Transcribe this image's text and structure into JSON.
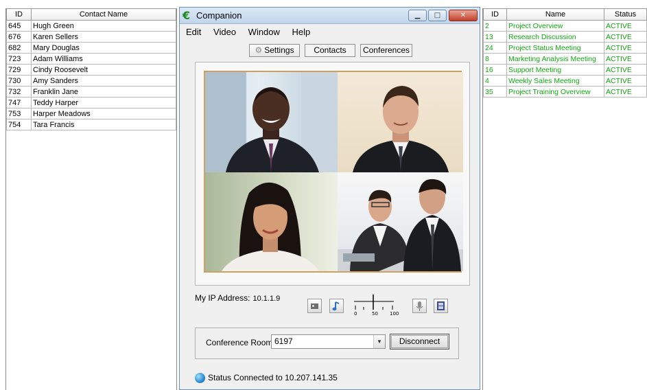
{
  "contacts": {
    "headers": [
      "ID",
      "Contact Name"
    ],
    "rows": [
      [
        "645",
        "Hugh Green"
      ],
      [
        "676",
        "Karen Sellers"
      ],
      [
        "682",
        "Mary Douglas"
      ],
      [
        "723",
        "Adam Williams"
      ],
      [
        "729",
        "Cindy Roosevelt"
      ],
      [
        "730",
        "Amy Sanders"
      ],
      [
        "732",
        "Franklin Jane"
      ],
      [
        "747",
        "Teddy Harper"
      ],
      [
        "753",
        "Harper Meadows"
      ],
      [
        "754",
        "Tara Francis"
      ]
    ]
  },
  "window": {
    "title": "Companion",
    "min_glyph": "▁",
    "max_glyph": "□",
    "close_glyph": "✕"
  },
  "menu": [
    "Edit",
    "Video",
    "Window",
    "Help"
  ],
  "tabs": {
    "settings": "Settings",
    "contacts": "Contacts",
    "conferences": "Conferences"
  },
  "ip": {
    "label": "My IP Address:",
    "value": "10.1.1.9"
  },
  "volume": {
    "ticks": [
      "0",
      "50",
      "100"
    ],
    "level": 0.5
  },
  "conference": {
    "label": "Conference Room",
    "value": "6197",
    "disconnect": "Disconnect"
  },
  "status": {
    "label": "Status",
    "text": "Connected to 10.207.141.35"
  },
  "meetings": {
    "headers": [
      "ID",
      "Name",
      "Status"
    ],
    "rows": [
      [
        "2",
        "Project Overview",
        "ACTIVE"
      ],
      [
        "13",
        "Research Discussion",
        "ACTIVE"
      ],
      [
        "24",
        "Project Status Meeting",
        "ACTIVE"
      ],
      [
        "8",
        "Marketing Analysis Meeting",
        "ACTIVE"
      ],
      [
        "16",
        "Support Meeting",
        "ACTIVE"
      ],
      [
        "4",
        "Weekly Sales Meeting",
        "ACTIVE"
      ],
      [
        "35",
        "Project Training Overview",
        "ACTIVE"
      ]
    ]
  },
  "colors": {
    "active_text": "#10a810",
    "title_bar": "#c1d6ec",
    "close_button": "#c0402a"
  }
}
